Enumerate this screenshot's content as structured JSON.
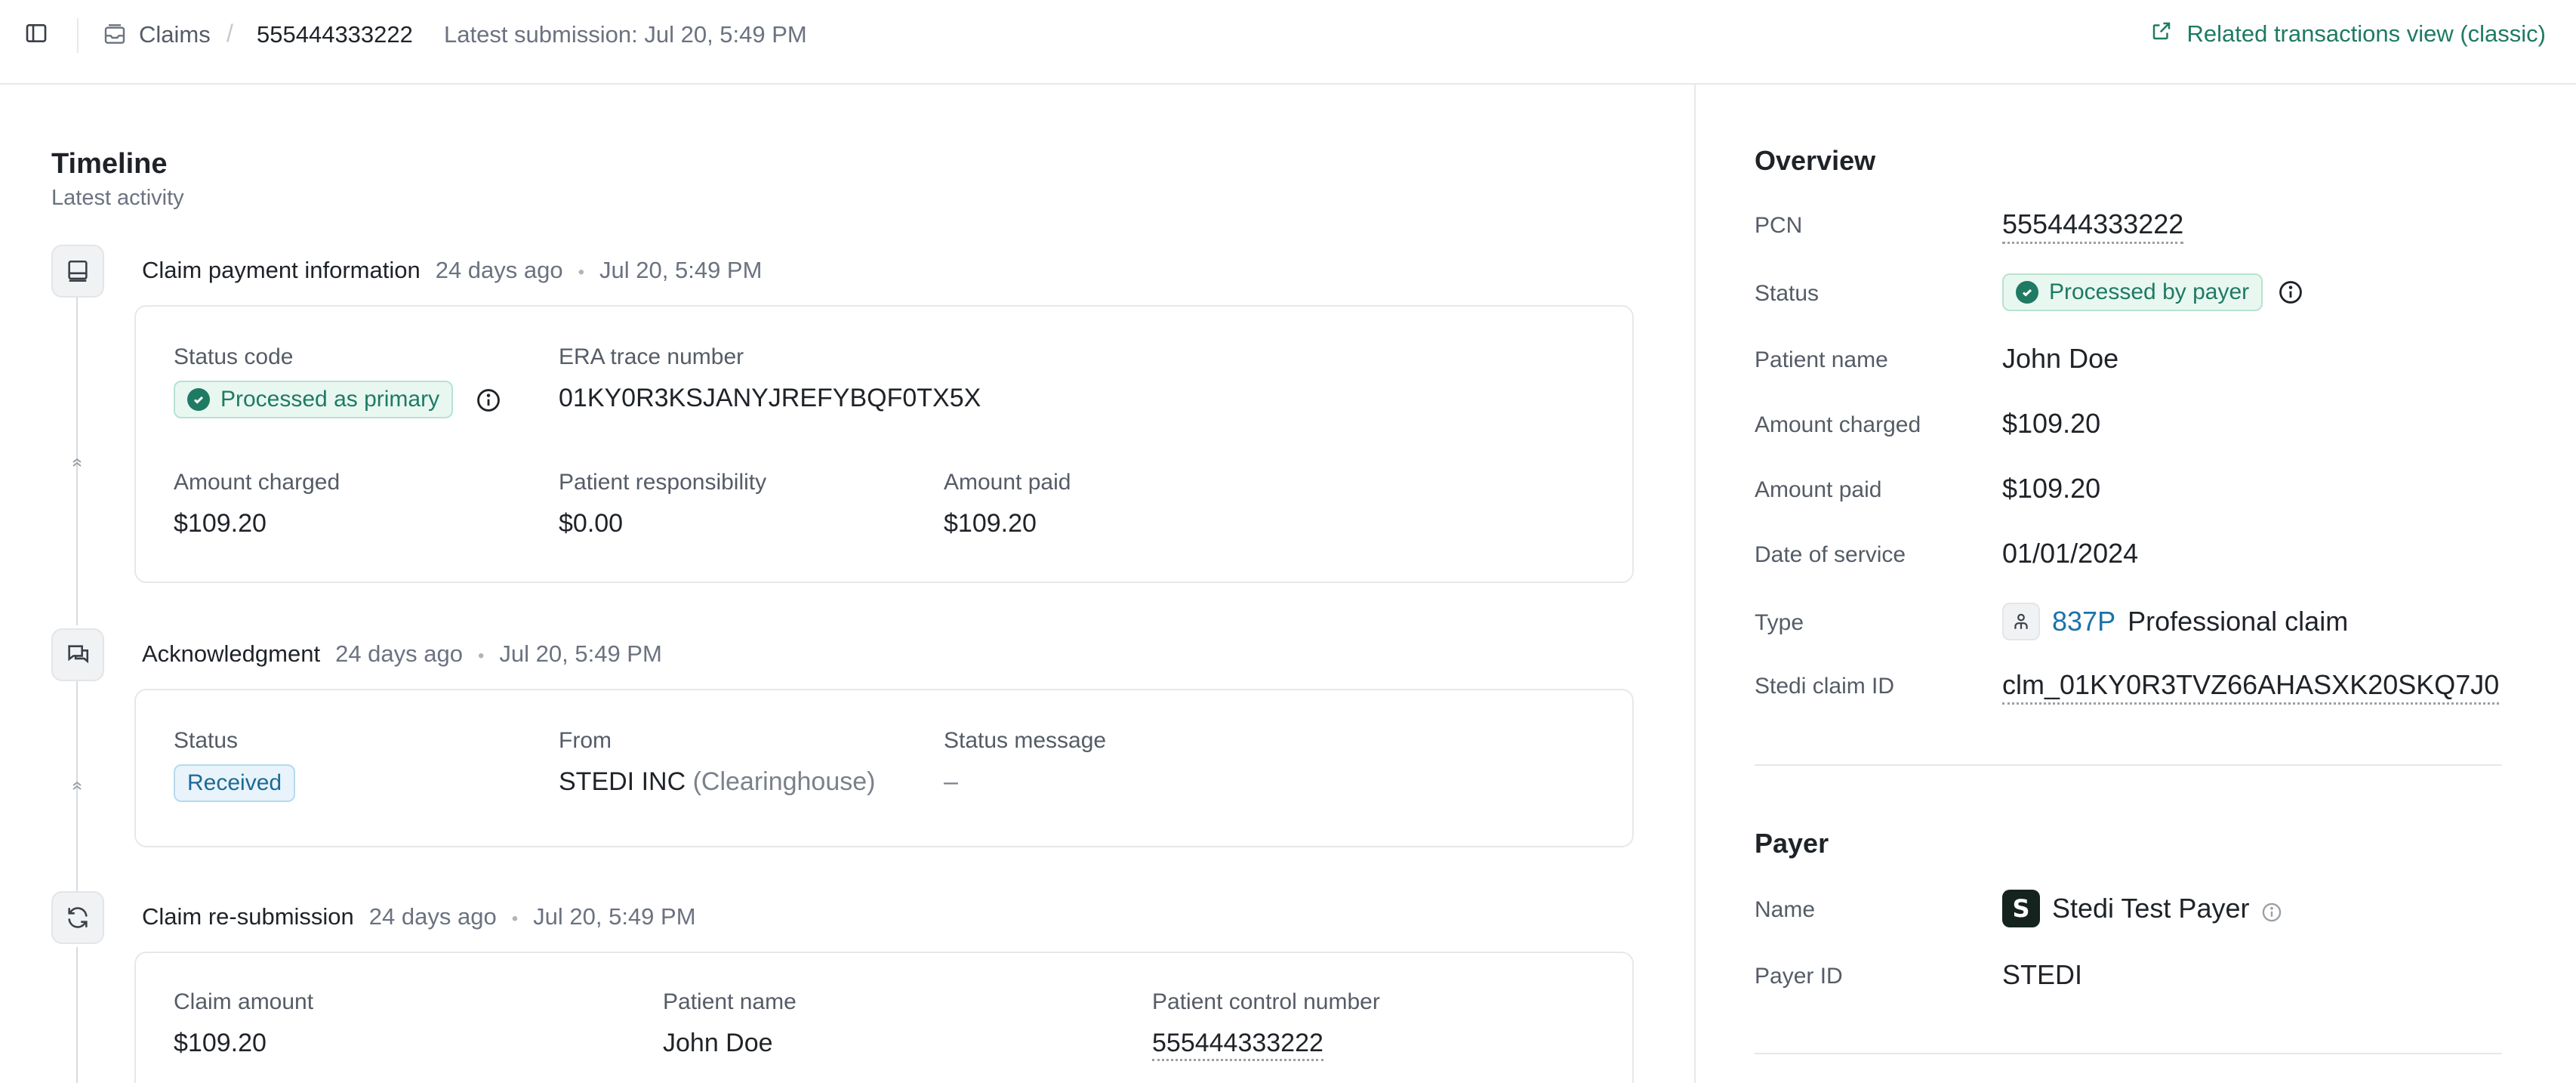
{
  "topbar": {
    "breadcrumb_root": "Claims",
    "separator": "/",
    "claim_id": "555444333222",
    "latest_submission": "Latest submission: Jul 20, 5:49 PM",
    "related_link": "Related transactions view (classic)"
  },
  "timeline": {
    "title": "Timeline",
    "subtitle": "Latest activity",
    "events": [
      {
        "title": "Claim payment information",
        "ago": "24 days ago",
        "dot": "•",
        "date": "Jul 20, 5:49 PM",
        "status_code_label": "Status code",
        "status_code_value": "Processed as primary",
        "era_label": "ERA trace number",
        "era_value": "01KY0R3KSJANYJREFYBQF0TX5X",
        "amount_charged_label": "Amount charged",
        "amount_charged_value": "$109.20",
        "patient_resp_label": "Patient responsibility",
        "patient_resp_value": "$0.00",
        "amount_paid_label": "Amount paid",
        "amount_paid_value": "$109.20"
      },
      {
        "title": "Acknowledgment",
        "ago": "24 days ago",
        "dot": "•",
        "date": "Jul 20, 5:49 PM",
        "status_label": "Status",
        "status_value": "Received",
        "from_label": "From",
        "from_value": "STEDI INC",
        "from_qualifier": "(Clearinghouse)",
        "message_label": "Status message",
        "message_value": "–"
      },
      {
        "title": "Claim re-submission",
        "ago": "24 days ago",
        "dot": "•",
        "date": "Jul 20, 5:49 PM",
        "claim_amount_label": "Claim amount",
        "claim_amount_value": "$109.20",
        "patient_name_label": "Patient name",
        "patient_name_value": "John Doe",
        "pcn_label": "Patient control number",
        "pcn_value": "555444333222"
      }
    ]
  },
  "overview": {
    "title": "Overview",
    "pcn_label": "PCN",
    "pcn_value": "555444333222",
    "status_label": "Status",
    "status_value": "Processed by payer",
    "patient_label": "Patient name",
    "patient_value": "John Doe",
    "charged_label": "Amount charged",
    "charged_value": "$109.20",
    "paid_label": "Amount paid",
    "paid_value": "$109.20",
    "dos_label": "Date of service",
    "dos_value": "01/01/2024",
    "type_label": "Type",
    "type_code": "837P",
    "type_value": "Professional claim",
    "claim_id_label": "Stedi claim ID",
    "claim_id_value": "clm_01KY0R3TVZ66AHASXK20SKQ7J0"
  },
  "payer": {
    "title": "Payer",
    "name_label": "Name",
    "logo_letter": "S",
    "name_value": "Stedi Test Payer",
    "id_label": "Payer ID",
    "id_value": "STEDI"
  },
  "colors": {
    "accent_green": "#1f7a63",
    "link_blue": "#1b72a8",
    "badge_blue": "#1c6a96"
  }
}
